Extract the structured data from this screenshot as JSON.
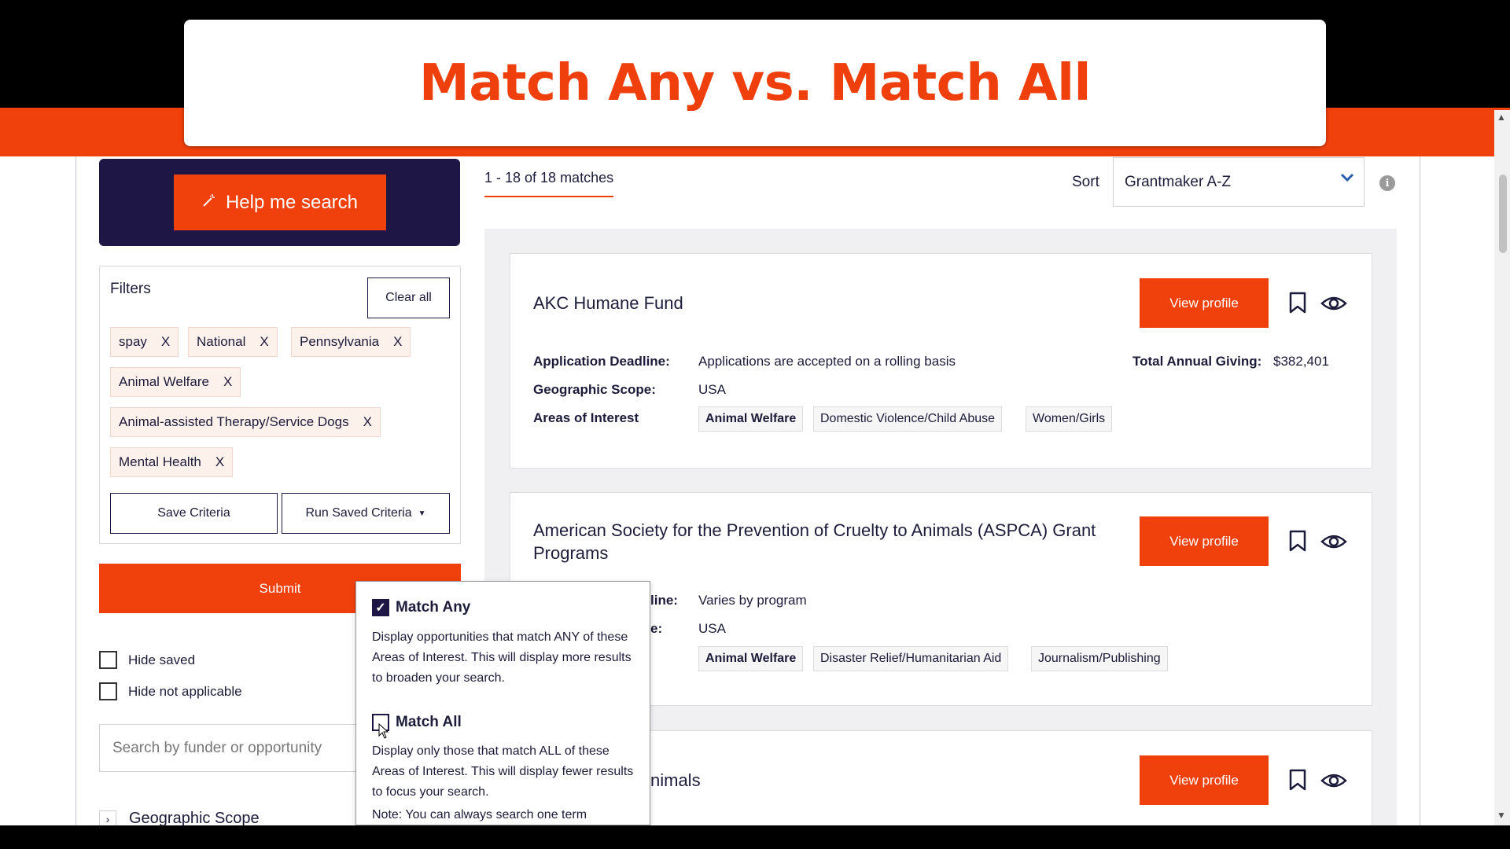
{
  "title_overlay": "Match Any vs. Match All",
  "help": {
    "label": "Help me search"
  },
  "filters": {
    "title": "Filters",
    "clear_all": "Clear all",
    "tags": [
      "spay",
      "National",
      "Pennsylvania",
      "Animal Welfare",
      "Animal-assisted Therapy/Service Dogs",
      "Mental Health"
    ],
    "remove_label": "X",
    "save_criteria": "Save Criteria",
    "run_saved_criteria": "Run Saved Criteria"
  },
  "submit": "Submit",
  "options": {
    "hide_saved": "Hide saved",
    "hide_not_applicable": "Hide not applicable"
  },
  "search": {
    "placeholder": "Search by funder or opportunity"
  },
  "geo_scope": "Geographic Scope",
  "results": {
    "count": "1 - 18 of 18 matches",
    "sort_label": "Sort",
    "sort_value": "Grantmaker A-Z",
    "cards": [
      {
        "title": "AKC Humane Fund",
        "view": "View profile",
        "deadline_label": "Application Deadline:",
        "deadline": "Applications are accepted on a rolling basis",
        "giving_label": "Total Annual Giving:",
        "giving": "$382,401",
        "scope_label": "Geographic Scope:",
        "scope": "USA",
        "aoi_label": "Areas of Interest",
        "aoi": [
          "Animal Welfare",
          "Domestic Violence/Child Abuse",
          "Women/Girls"
        ]
      },
      {
        "title": "American Society for the Prevention of Cruelty to Animals (ASPCA) Grant Programs",
        "view": "View profile",
        "deadline_partial": "line:",
        "deadline": "Varies by program",
        "scope_partial": "e:",
        "scope": "USA",
        "aoi": [
          "Animal Welfare",
          "Disaster Relief/Humanitarian Aid",
          "Journalism/Publishing"
        ]
      },
      {
        "title_partial": "nimals",
        "view": "View profile"
      }
    ]
  },
  "popover": {
    "match_any": "Match Any",
    "match_any_desc": "Display opportunities that match ANY of these Areas of Interest. This will display more results to broaden your search.",
    "match_all": "Match All",
    "match_all_desc": "Display only those that match ALL of these Areas of Interest. This will display fewer results to focus your search.",
    "note": "Note: You can always search one term"
  },
  "colors": {
    "accent": "#f0400c",
    "navy": "#1e1645"
  }
}
